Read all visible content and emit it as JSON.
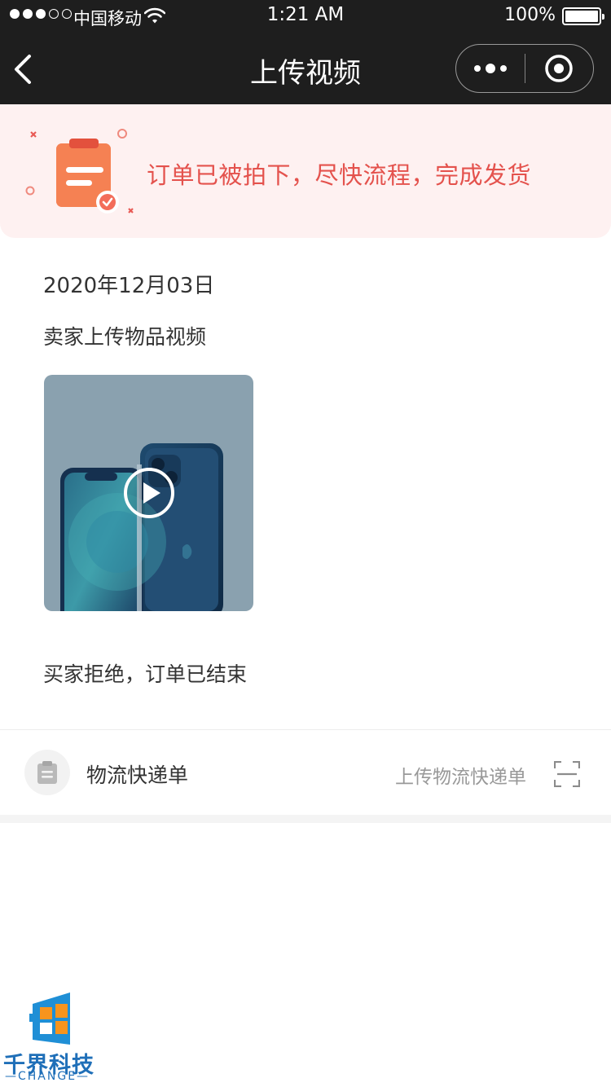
{
  "status_bar": {
    "carrier": "中国移动",
    "time": "1:21 AM",
    "battery": "100%",
    "battery_level": 1.0
  },
  "nav": {
    "title": "上传视频",
    "back_icon": "chevron-left-icon",
    "more_icon": "more-dots-icon",
    "close_icon": "target-circle-icon"
  },
  "banner": {
    "text": "订单已被拍下，尽快流程，完成发货",
    "icon": "clipboard-check-icon",
    "color": "#e4524d",
    "background": "#fef1f1"
  },
  "content": {
    "date": "2020年12月03日",
    "section_label": "卖家上传物品视频",
    "video": {
      "icon": "play-icon"
    },
    "result_text": "买家拒绝，订单已结束"
  },
  "logistics": {
    "label": "物流快递单",
    "action": "上传物流快递单",
    "icon": "clipboard-icon",
    "scan_icon": "scan-icon"
  },
  "watermark": {
    "name": "千界科技",
    "sub": "—CHANGE—"
  }
}
